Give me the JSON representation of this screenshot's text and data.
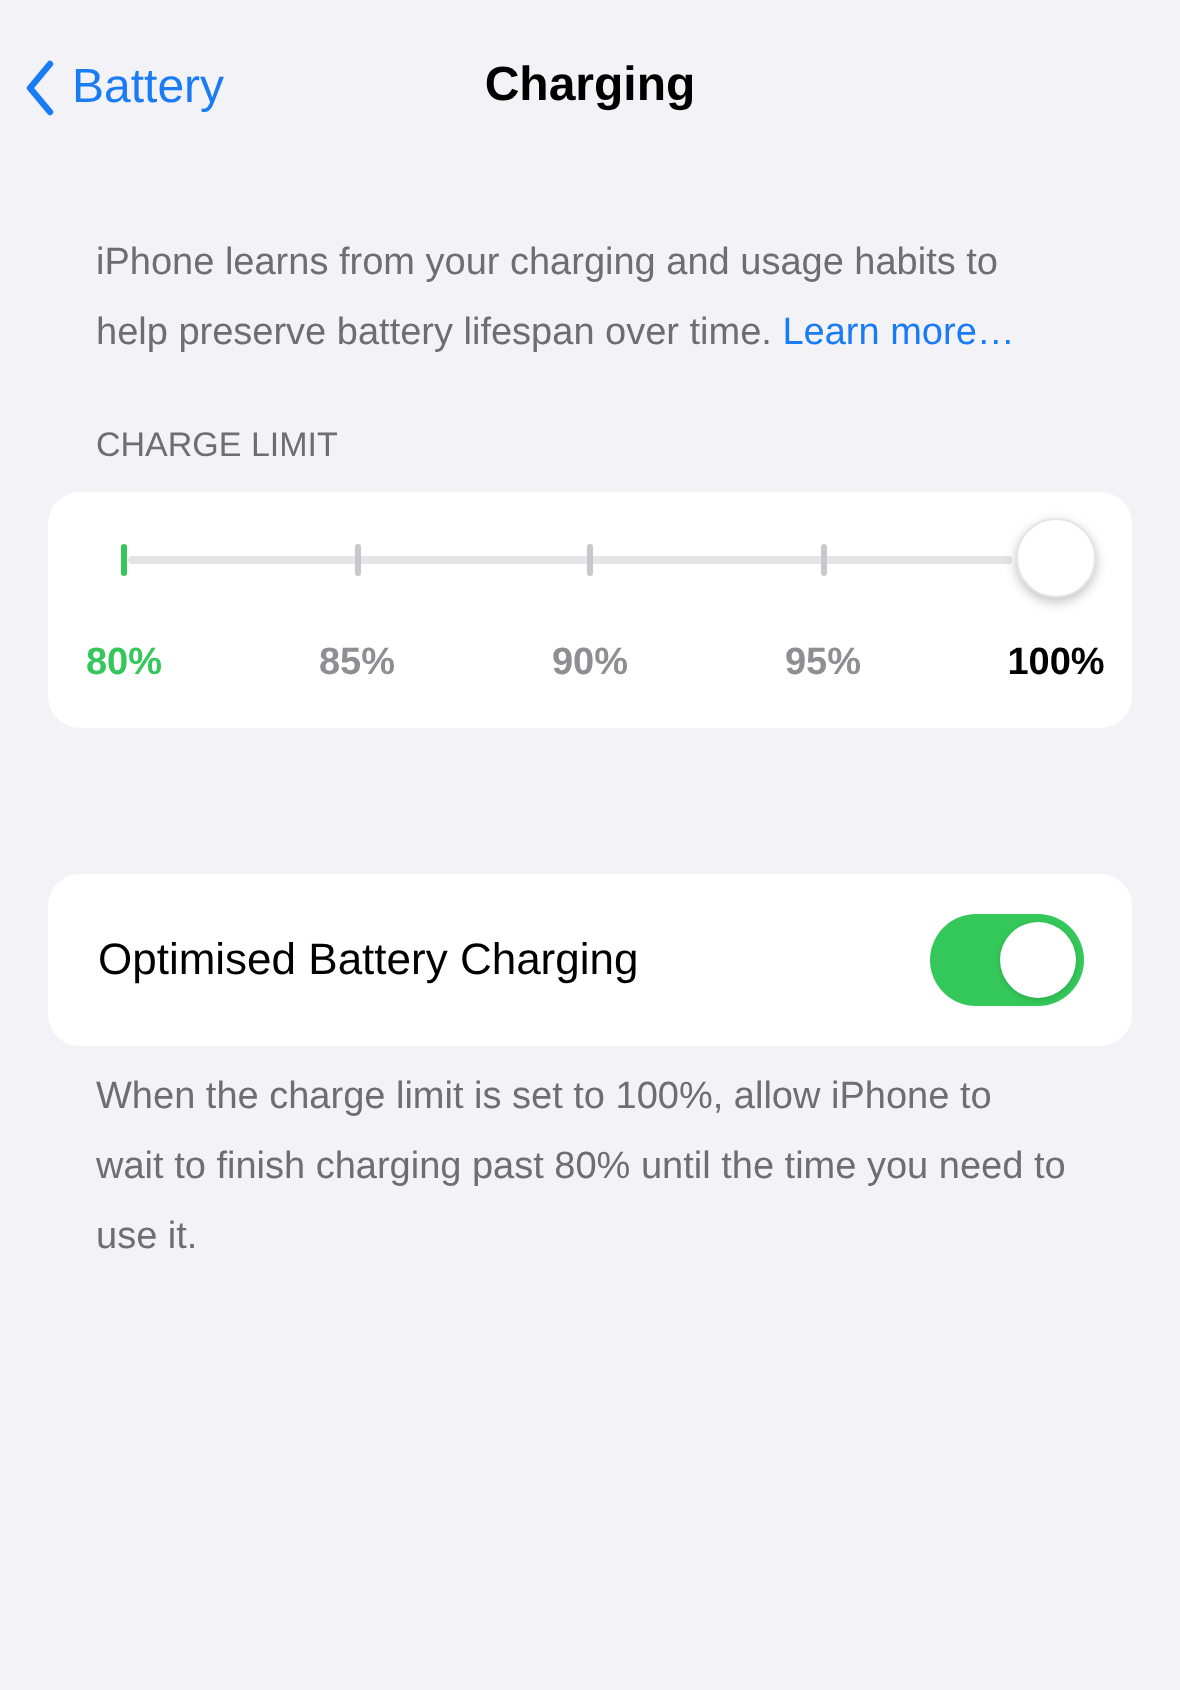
{
  "nav": {
    "back": "Battery",
    "title": "Charging"
  },
  "description": {
    "text": "iPhone learns from your charging and usage habits to help preserve battery lifespan over time.",
    "link": "Learn more…"
  },
  "charge_limit": {
    "header": "CHARGE LIMIT",
    "level": 1,
    "stops": [
      {
        "label": "80%",
        "selected": false
      },
      {
        "label": "85%",
        "selected": false
      },
      {
        "label": "90%",
        "selected": false
      },
      {
        "label": "95%",
        "selected": false
      },
      {
        "label": "100%",
        "selected": true
      }
    ]
  },
  "optimised": {
    "label": "Optimised Battery Charging",
    "on": true,
    "footer": "When the charge limit is set to 100%, allow iPhone to wait to finish charging past 80% until the time you need to use it."
  }
}
